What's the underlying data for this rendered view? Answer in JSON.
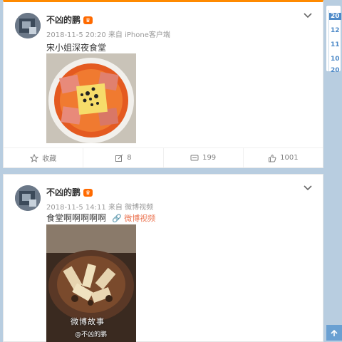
{
  "posts": [
    {
      "user": "不凶的鹏",
      "time": "2018-11-5 20:20",
      "source": "来自 iPhone客户端",
      "text": "宋小姐深夜食堂",
      "actions": {
        "favorite": "收藏",
        "repost": "8",
        "comment": "199",
        "like": "1001"
      }
    },
    {
      "user": "不凶的鹏",
      "time": "2018-11-5 14:11",
      "source": "来自 微博视频",
      "text": "食堂啊啊啊啊啊",
      "video_link": "微博视频",
      "watermark": "微博故事",
      "watermark_user": "@不凶的鹏"
    }
  ],
  "sidebar": {
    "timeline": [
      "20",
      "12",
      "11",
      "10",
      "20"
    ],
    "active_index": 0
  },
  "colors": {
    "accent": "#eb7350",
    "link": "#4e8ac8",
    "vip": "#ff6a00"
  },
  "icons": {
    "favorite": "star-icon",
    "repost": "repost-icon",
    "comment": "comment-icon",
    "like": "thumb-up-icon",
    "more": "chevron-down-icon",
    "back_top": "arrow-up-icon"
  }
}
